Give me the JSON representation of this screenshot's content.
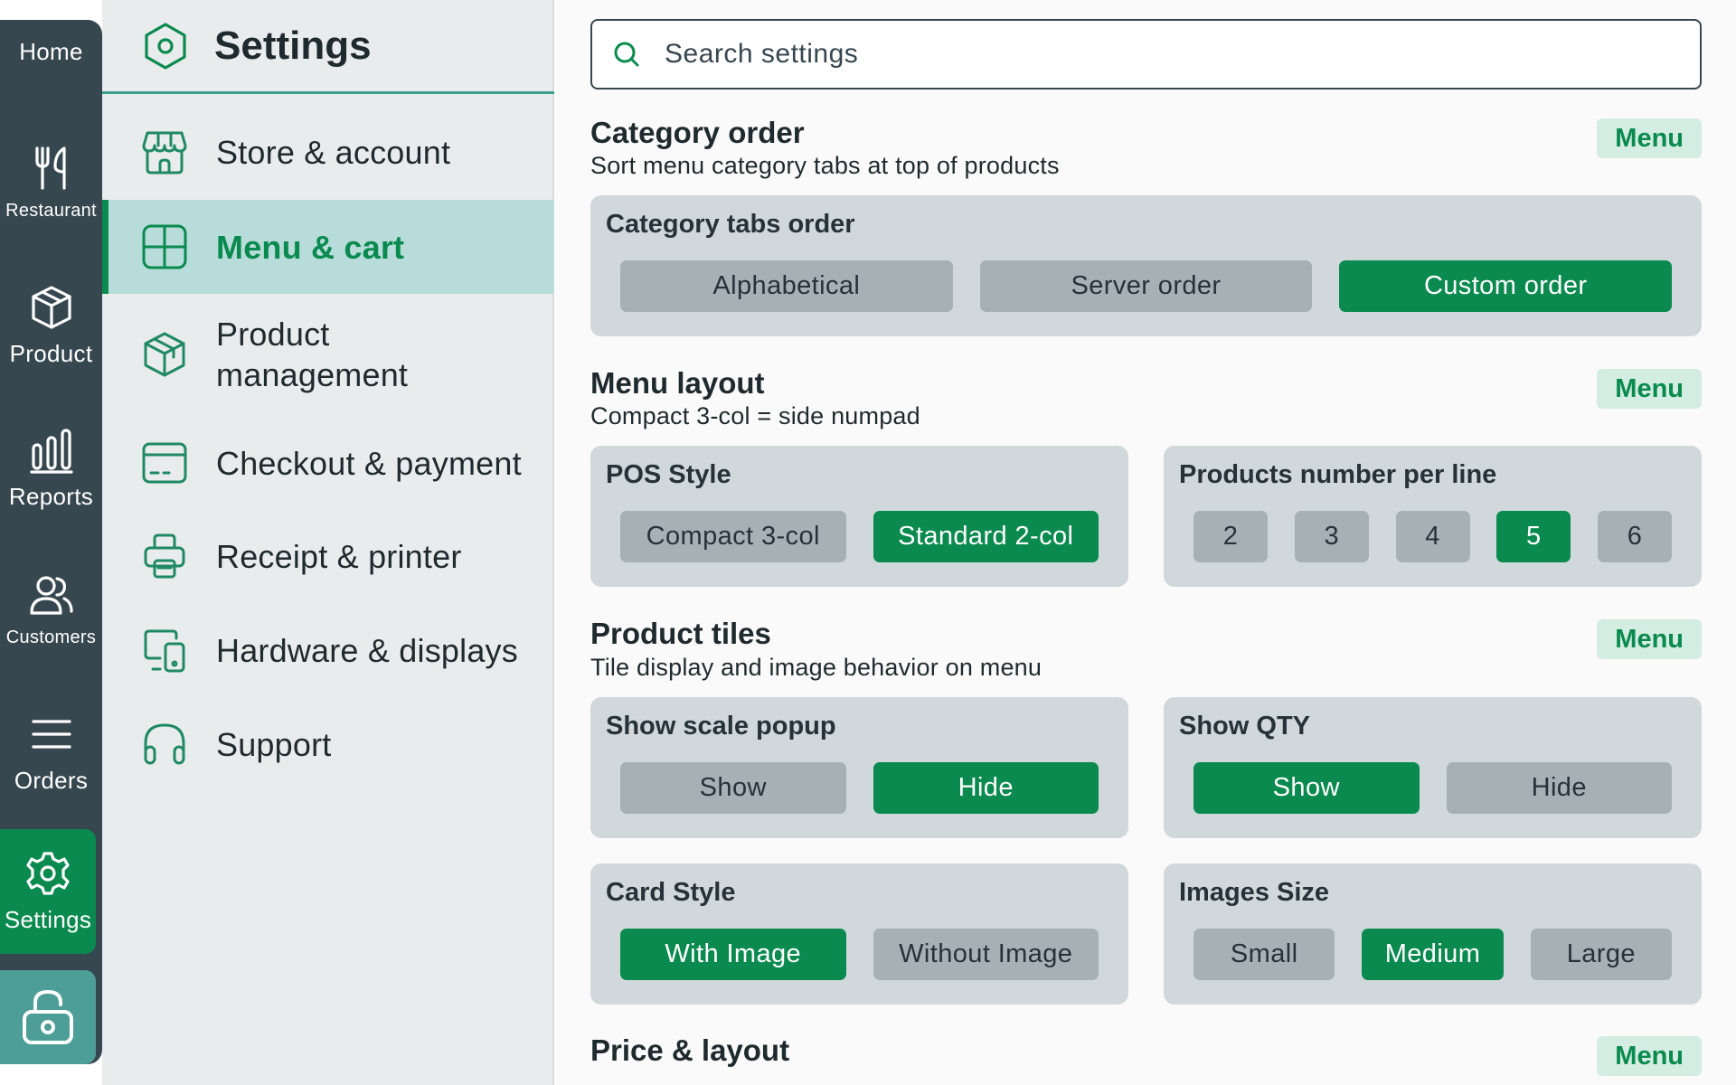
{
  "rail": {
    "items": [
      {
        "label": "Home",
        "icon": "home-icon"
      },
      {
        "label": "Restaurant",
        "icon": "fork-knife-icon"
      },
      {
        "label": "Product",
        "icon": "box-icon"
      },
      {
        "label": "Reports",
        "icon": "bar-chart-icon"
      },
      {
        "label": "Customers",
        "icon": "users-icon"
      },
      {
        "label": "Orders",
        "icon": "list-icon"
      },
      {
        "label": "Settings",
        "icon": "gear-icon",
        "active": true
      }
    ],
    "lock_icon": "unlock-icon"
  },
  "nav": {
    "title": "Settings",
    "items": [
      {
        "label": "Store & account",
        "icon": "storefront-icon"
      },
      {
        "label": "Menu & cart",
        "icon": "layout-icon",
        "active": true
      },
      {
        "label": "Product management",
        "icon": "package-icon"
      },
      {
        "label": "Checkout & payment",
        "icon": "card-icon"
      },
      {
        "label": "Receipt & printer",
        "icon": "printer-icon"
      },
      {
        "label": "Hardware & displays",
        "icon": "devices-icon"
      },
      {
        "label": "Support",
        "icon": "headphones-icon"
      }
    ]
  },
  "search": {
    "placeholder": "Search settings"
  },
  "sections": {
    "category_order": {
      "title": "Category order",
      "subtitle": "Sort menu category tabs at top of products",
      "badge": "Menu",
      "tabs_order": {
        "title": "Category tabs order",
        "options": [
          "Alphabetical",
          "Server order",
          "Custom order"
        ],
        "selected": "Custom order"
      }
    },
    "menu_layout": {
      "title": "Menu layout",
      "subtitle": "Compact 3-col = side numpad",
      "badge": "Menu",
      "pos_style": {
        "title": "POS Style",
        "options": [
          "Compact 3-col",
          "Standard 2-col"
        ],
        "selected": "Standard 2-col"
      },
      "per_line": {
        "title": "Products number per line",
        "options": [
          "2",
          "3",
          "4",
          "5",
          "6"
        ],
        "selected": "5"
      }
    },
    "product_tiles": {
      "title": "Product tiles",
      "subtitle": "Tile display and image behavior on menu",
      "badge": "Menu",
      "scale_popup": {
        "title": "Show scale popup",
        "options": [
          "Show",
          "Hide"
        ],
        "selected": "Hide"
      },
      "show_qty": {
        "title": "Show QTY",
        "options": [
          "Show",
          "Hide"
        ],
        "selected": "Show"
      },
      "card_style": {
        "title": "Card Style",
        "options": [
          "With Image",
          "Without Image"
        ],
        "selected": "With Image"
      },
      "images_size": {
        "title": "Images Size",
        "options": [
          "Small",
          "Medium",
          "Large"
        ],
        "selected": "Medium"
      }
    },
    "price_layout": {
      "title": "Price & layout",
      "badge": "Menu"
    }
  },
  "colors": {
    "accent": "#0a8a4e",
    "rail": "#37474f",
    "card": "#d0d8dc",
    "button": "#a6b1b6",
    "badge_bg": "#d4ede2"
  }
}
